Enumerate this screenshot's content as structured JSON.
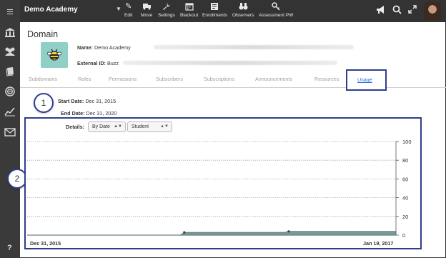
{
  "app": {
    "academy_name": "Demo Academy",
    "toolbar": [
      {
        "label": "Edit",
        "icon": "pencil-icon"
      },
      {
        "label": "Move",
        "icon": "truck-icon"
      },
      {
        "label": "Settings",
        "icon": "wrench-icon"
      },
      {
        "label": "Blackout",
        "icon": "calendar-icon"
      },
      {
        "label": "Enrollments",
        "icon": "enrollments-icon"
      },
      {
        "label": "Observers",
        "icon": "binoculars-icon"
      },
      {
        "label": "Assessment PW",
        "icon": "key-icon"
      }
    ],
    "right_icons": [
      "megaphone-icon",
      "search-icon",
      "expand-icon"
    ]
  },
  "sidebar": {
    "icons": [
      "menu-icon",
      "institution-icon",
      "users-icon",
      "book-icon",
      "target-icon",
      "chart-icon",
      "mail-icon",
      "help-icon"
    ],
    "help_label": "?"
  },
  "domain": {
    "title": "Domain",
    "name_label": "Name:",
    "name_value": "Demo Academy",
    "external_id_label": "External ID:",
    "external_id_value": "Buzz"
  },
  "tabs": [
    {
      "label": "Subdomains",
      "active": false
    },
    {
      "label": "Roles",
      "active": false
    },
    {
      "label": "Permissions",
      "active": false
    },
    {
      "label": "Subscribers",
      "active": false
    },
    {
      "label": "Subscriptions",
      "active": false
    },
    {
      "label": "Announcements",
      "active": false
    },
    {
      "label": "Resources",
      "active": false
    },
    {
      "label": "Usage",
      "active": true
    }
  ],
  "callouts": [
    "1",
    "2"
  ],
  "usage": {
    "start_date_label": "Start Date:",
    "start_date_value": "Dec 31, 2015",
    "end_date_label": "End Date:",
    "end_date_value": "Dec 31, 2020",
    "details_label": "Details:",
    "details_by": "By Date",
    "details_role": "Student"
  },
  "colors": {
    "topbar": "#333333",
    "sidebar": "#3a3a3a",
    "highlight_border": "#2f3e8c",
    "active_tab": "#2b6fd6",
    "area_fill": "#7d9a9a",
    "logo_bg": "#8fcfc6"
  },
  "chart_data": {
    "type": "area",
    "x_start_label": "Dec 31, 2015",
    "x_end_label": "Jan 19, 2017",
    "y_ticks": [
      0,
      20,
      40,
      60,
      80,
      100
    ],
    "ylim": [
      0,
      100
    ],
    "grid": "dotted horizontal",
    "y_axis_side": "right",
    "points": [
      {
        "x": "2015-12-31",
        "y": 0
      },
      {
        "x": "2016-06-08",
        "y": 0
      },
      {
        "x": "2016-06-12",
        "y": 3
      },
      {
        "x": "2016-09-25",
        "y": 3
      },
      {
        "x": "2016-09-29",
        "y": 4
      },
      {
        "x": "2017-01-19",
        "y": 4
      }
    ]
  }
}
